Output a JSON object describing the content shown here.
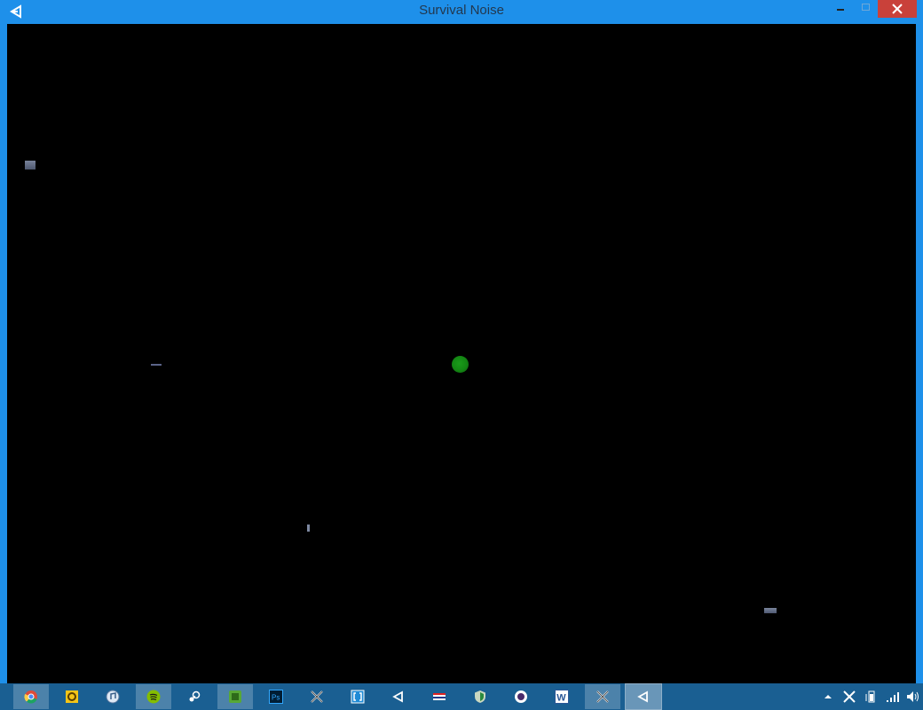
{
  "window": {
    "title": "Survival Noise",
    "app_icon": "unity-icon",
    "controls": [
      "minimize-icon",
      "maximize-icon",
      "close-icon"
    ]
  },
  "colors": {
    "window_frame": "#1e90ea",
    "close_button": "#c9413a",
    "viewport_background": "#000000",
    "player": "#138613",
    "object": "#5f6a80",
    "taskbar": "#1a5f92"
  },
  "game": {
    "player_icon": "green-circle",
    "objects": [
      "grey-block",
      "grey-line",
      "grey-sliver",
      "grey-block"
    ]
  },
  "taskbar": {
    "apps": [
      "chrome-icon",
      "outlook-icon",
      "itunes-icon",
      "spotify-icon",
      "steam-icon",
      "evernote-icon",
      "photoshop-icon",
      "xsplit-icon",
      "brackets-icon",
      "unity-icon",
      "flag-icon",
      "shield-icon",
      "circle-app-icon",
      "word-icon",
      "xsplit-icon",
      "unity-icon"
    ],
    "tray": [
      "show-hidden-icons-arrow",
      "xsplit-tray-icon",
      "battery-icon",
      "signal-icon",
      "volume-icon"
    ]
  }
}
